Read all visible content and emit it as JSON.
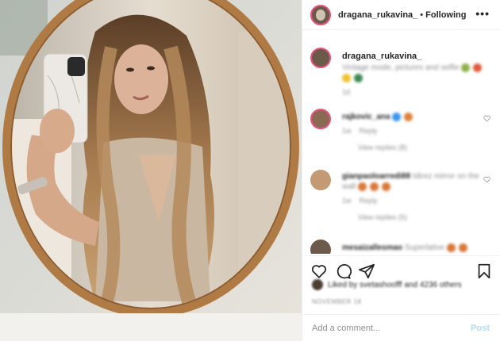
{
  "header": {
    "username": "dragana_rukavina_",
    "separator": "•",
    "follow_status": "Following",
    "more_icon": "more-horizontal-icon"
  },
  "caption": {
    "username": "dragana_rukavina_",
    "text": "Vintage mode, pictures and selfie",
    "time": "1d"
  },
  "comments": [
    {
      "username": "rajkovic_ana",
      "text": "",
      "time": "1w",
      "reply": "Reply",
      "view_replies": "View replies (8)"
    },
    {
      "username": "gianpaoloarredi88",
      "text": "Idirez mirror on the wall",
      "time": "1w",
      "reply": "Reply",
      "view_replies": "View replies (5)"
    },
    {
      "username": "mesaizallesmao",
      "text": "Superlative"
    }
  ],
  "actions": {
    "like_icon": "heart-icon",
    "comment_icon": "comment-icon",
    "share_icon": "paper-plane-icon",
    "save_icon": "bookmark-icon"
  },
  "likes": {
    "text": "Liked by svetashoofff and 4236 others"
  },
  "date": "NOVEMBER 18",
  "add_comment": {
    "placeholder": "Add a comment...",
    "post_label": "Post"
  },
  "colors": {
    "story_ring": "#e9537a",
    "mirror_frame": "#b07a44",
    "post_disabled": "#b3dbff",
    "border": "#efefef"
  }
}
